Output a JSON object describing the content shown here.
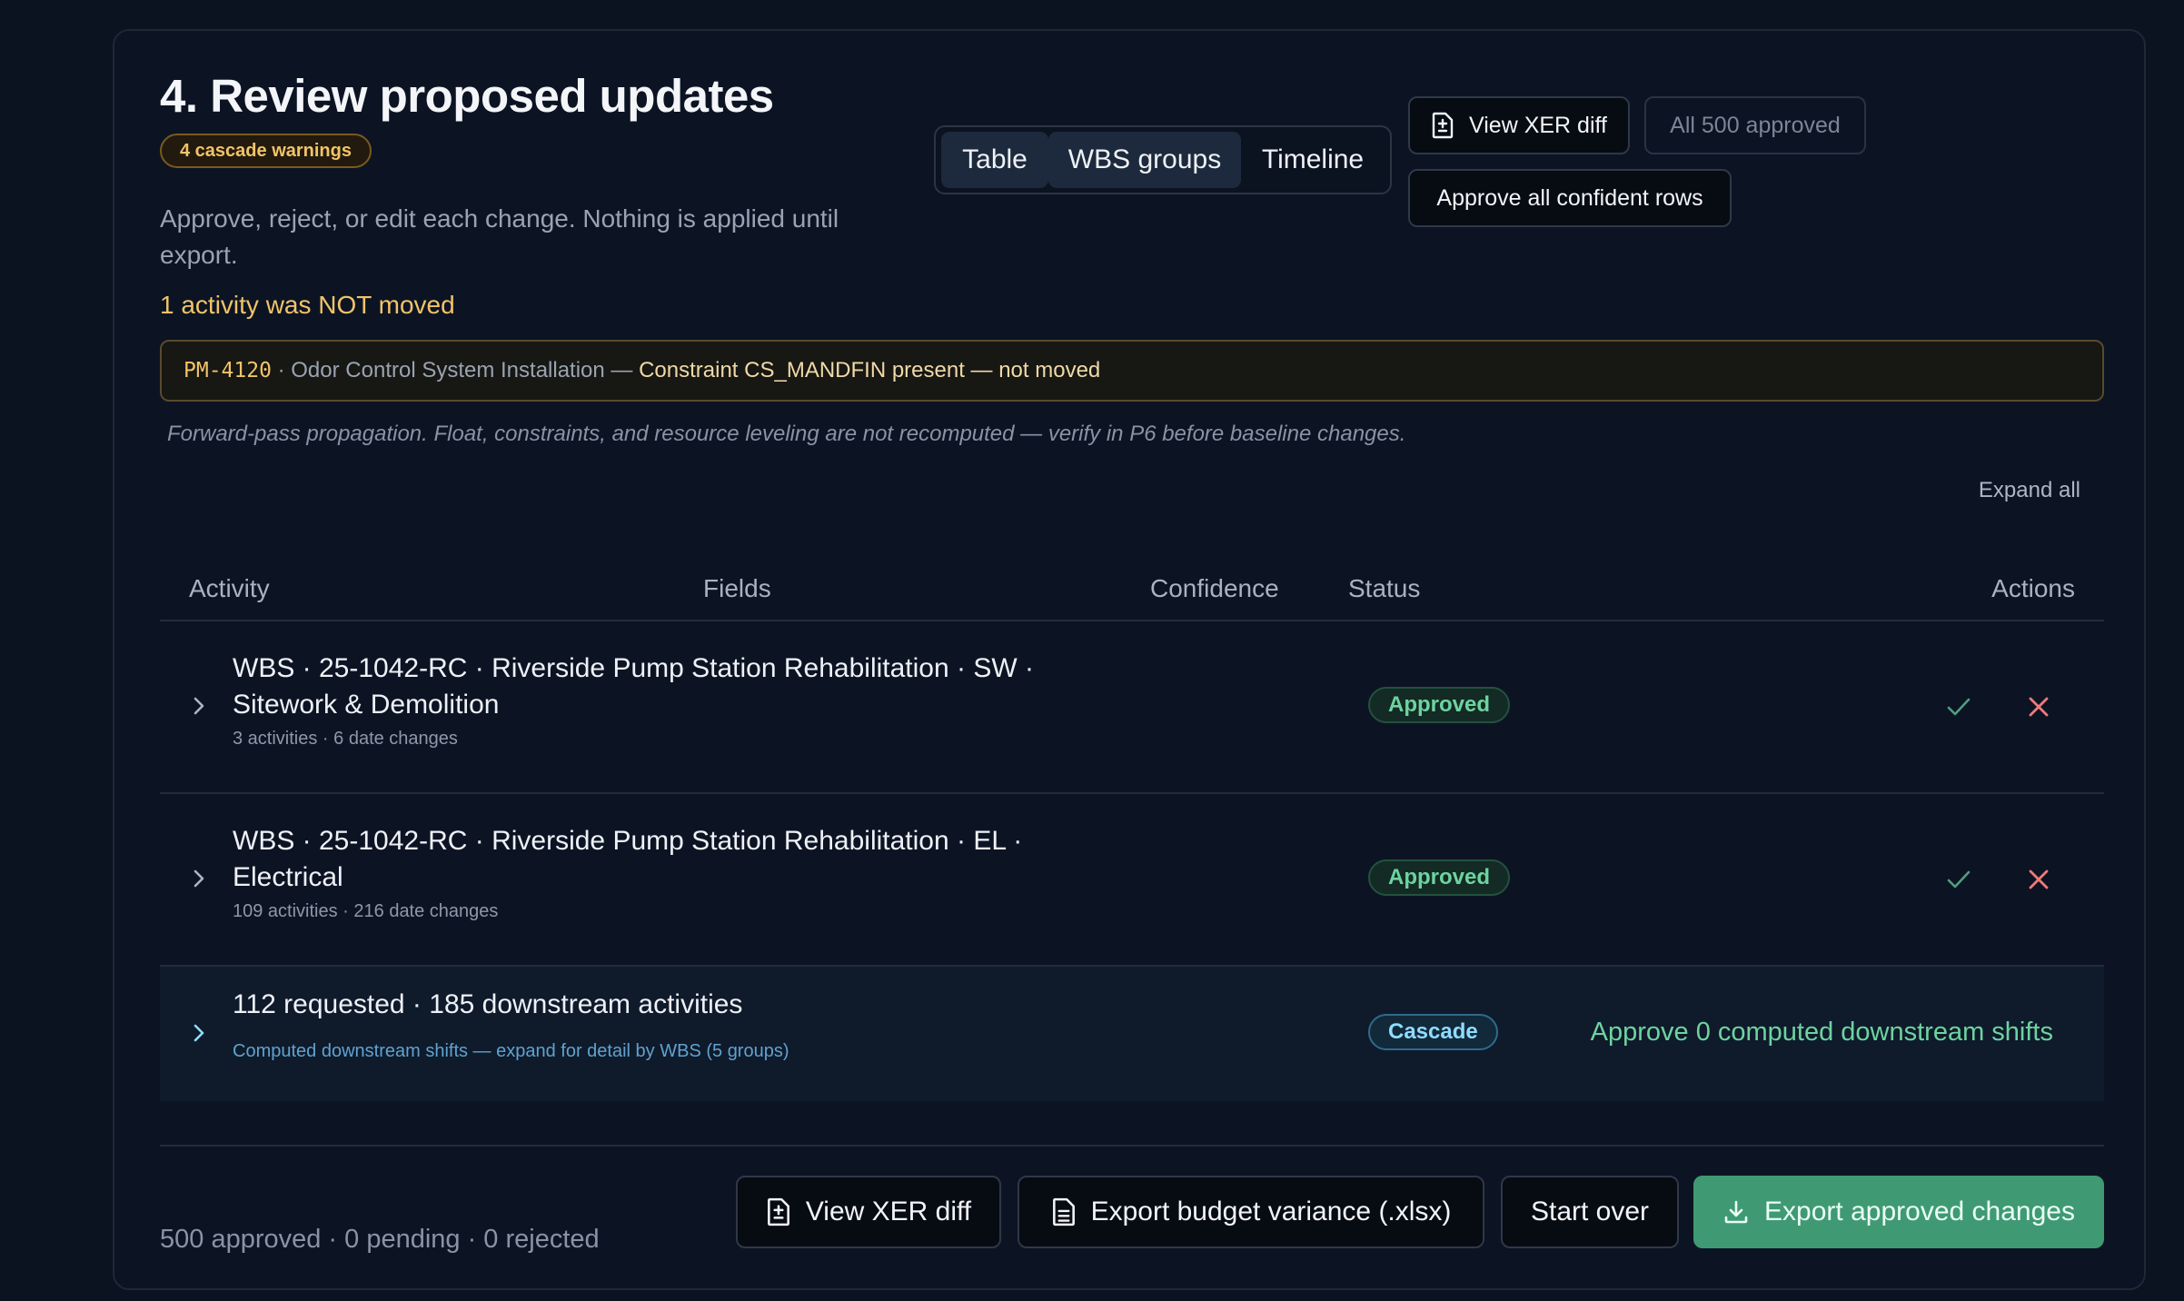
{
  "header": {
    "title": "4. Review proposed updates",
    "warning_badge": "4 cascade warnings",
    "subtitle": "Approve, reject, or edit each change. Nothing is applied until export."
  },
  "view_tabs": {
    "items": [
      {
        "label": "Table",
        "active": true
      },
      {
        "label": "WBS groups",
        "active": true
      },
      {
        "label": "Timeline",
        "active": false
      }
    ]
  },
  "toolbar": {
    "view_xer_diff": "View XER diff",
    "all_approved": "All 500 approved",
    "approve_confident": "Approve all confident rows"
  },
  "not_moved": {
    "heading": "1 activity was NOT moved",
    "code": "PM-4120",
    "separator": " · ",
    "activity_name": "Odor Control System Installation — ",
    "reason": "Constraint CS_MANDFIN present — not moved"
  },
  "note": "Forward-pass propagation. Float, constraints, and resource leveling are not recomputed — verify in P6 before baseline changes.",
  "expand_all": "Expand all",
  "table": {
    "headers": {
      "activity": "Activity",
      "fields": "Fields",
      "confidence": "Confidence",
      "status": "Status",
      "actions": "Actions"
    },
    "rows": [
      {
        "title": "WBS · 25-1042-RC · Riverside Pump Station Rehabilitation · SW · Sitework & Demolition",
        "meta": "3 activities · 6 date changes",
        "status": "Approved"
      },
      {
        "title": "WBS · 25-1042-RC · Riverside Pump Station Rehabilitation · EL · Electrical",
        "meta": "109 activities · 216 date changes",
        "status": "Approved"
      }
    ],
    "cascade_row": {
      "title": "112 requested · 185 downstream activities",
      "meta": "Computed downstream shifts — expand for detail by WBS (5 groups)",
      "status": "Cascade",
      "action": "Approve 0 computed downstream shifts"
    }
  },
  "footer": {
    "summary": "500 approved · 0 pending · 0 rejected",
    "view_xer_diff": "View XER diff",
    "export_budget": "Export budget variance (.xlsx)",
    "start_over": "Start over",
    "export_approved": "Export approved changes"
  },
  "colors": {
    "background": "#0b1220",
    "card": "#0c1424",
    "warning": "#f1c468",
    "success": "#6dd3a0",
    "reject": "#f07a7a",
    "cascade": "#8fdcff",
    "primary_button": "#3f9a73"
  }
}
